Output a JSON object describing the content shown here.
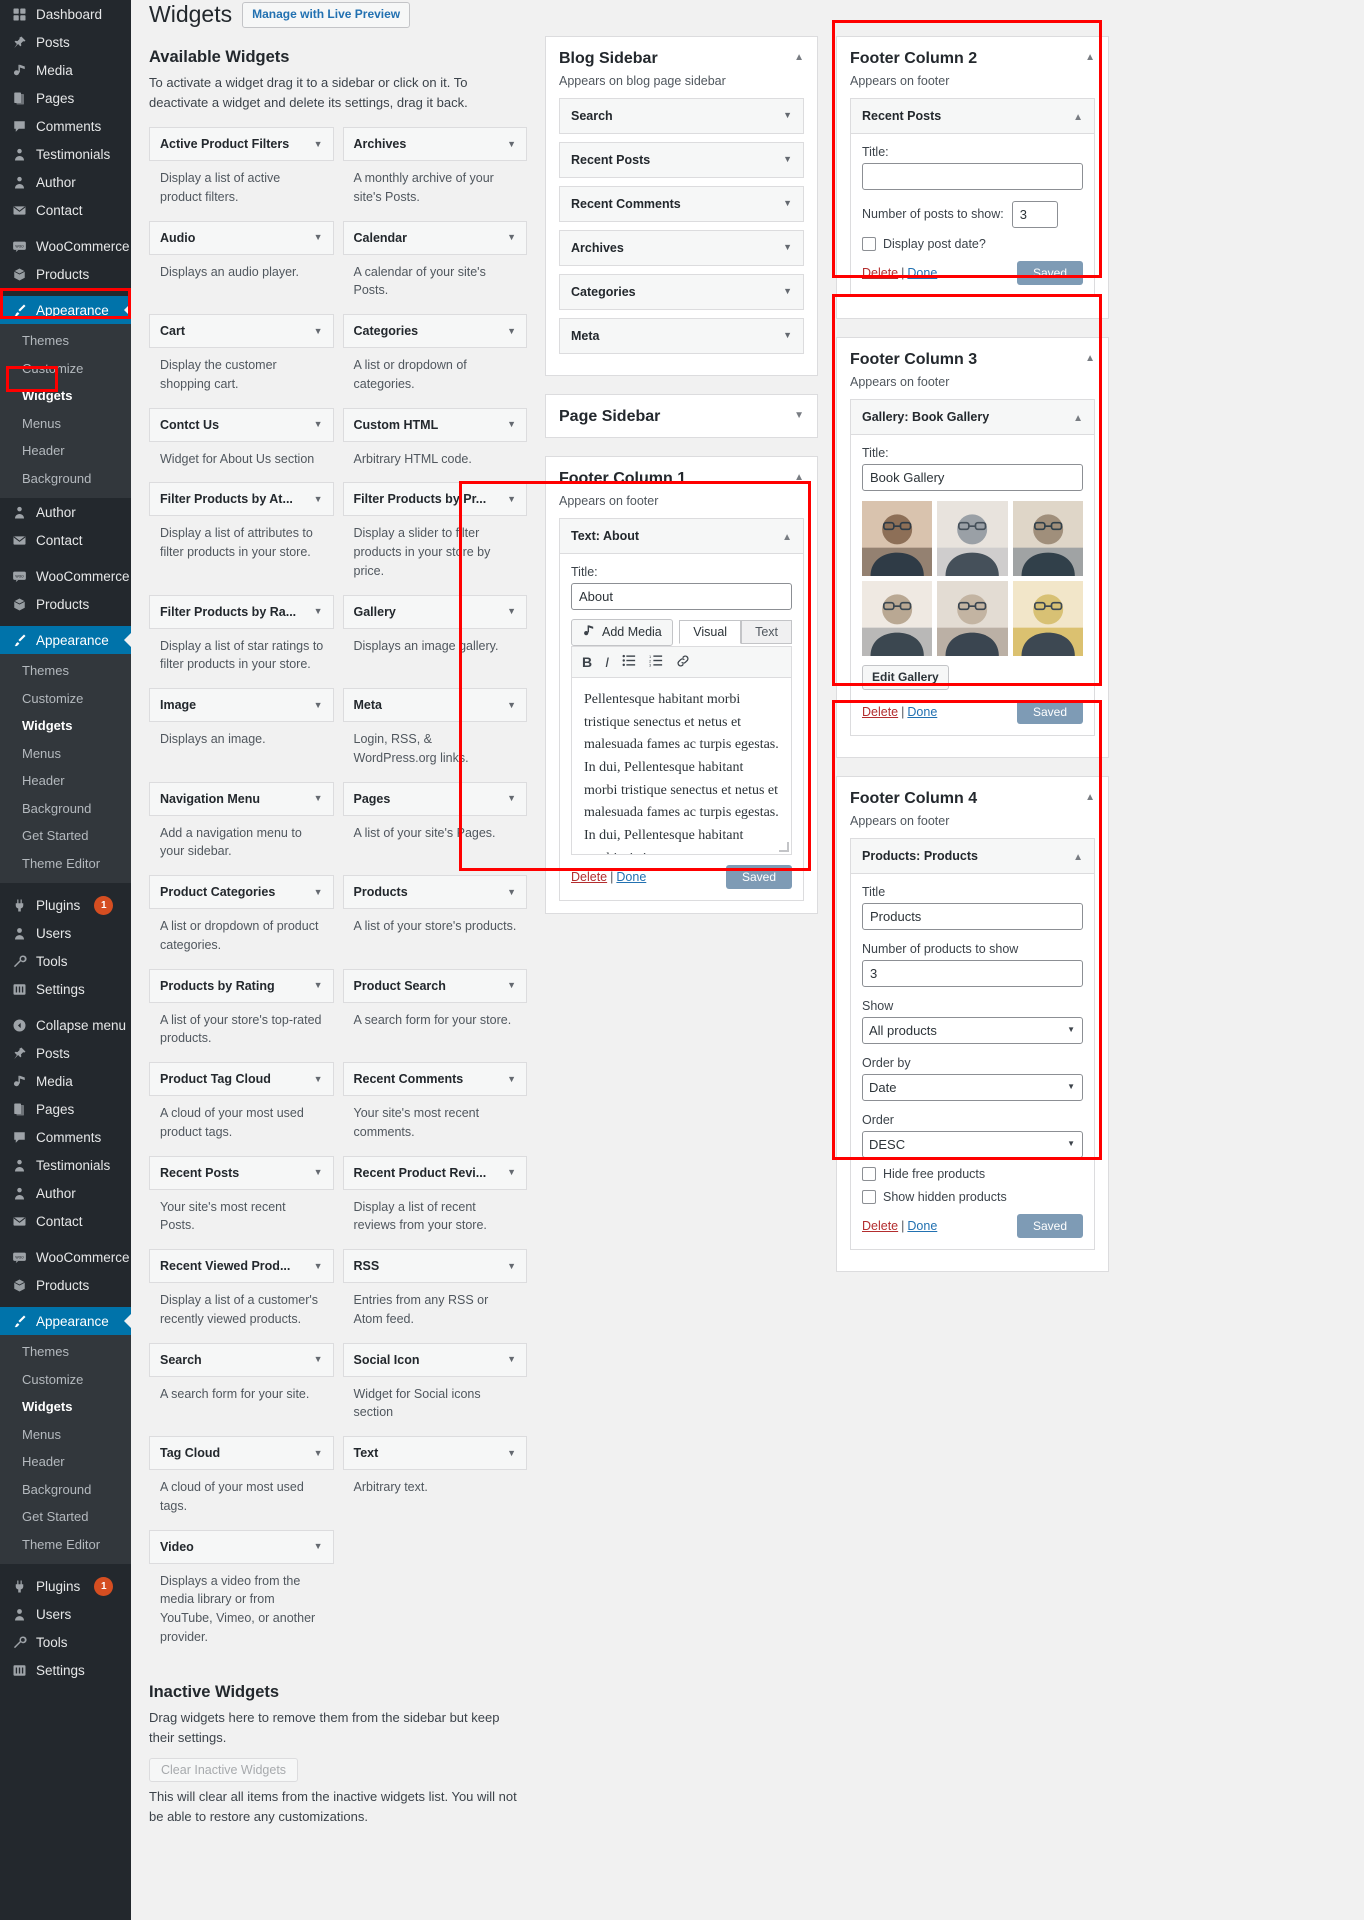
{
  "sidebar": {
    "blocks": [
      {
        "items": [
          {
            "label": "Dashboard",
            "icon": "dashboard-icon",
            "partial": true
          },
          {
            "label": "Posts",
            "icon": "pin-icon"
          },
          {
            "label": "Media",
            "icon": "media-icon"
          },
          {
            "label": "Pages",
            "icon": "pages-icon"
          },
          {
            "label": "Comments",
            "icon": "comments-icon"
          },
          {
            "label": "Testimonials",
            "icon": "user-icon"
          },
          {
            "label": "Author",
            "icon": "user-icon"
          },
          {
            "label": "Contact",
            "icon": "mail-icon"
          },
          {
            "label": "WooCommerce",
            "icon": "woo-icon",
            "gap": true
          },
          {
            "label": "Products",
            "icon": "box-icon"
          },
          {
            "label": "Appearance",
            "icon": "brush-icon",
            "current": true,
            "gap": true
          }
        ],
        "submenu": [
          {
            "label": "Themes"
          },
          {
            "label": "Customize"
          },
          {
            "label": "Widgets",
            "current": true
          },
          {
            "label": "Menus"
          },
          {
            "label": "Header"
          },
          {
            "label": "Background"
          }
        ]
      },
      {
        "items": [
          {
            "label": "Author",
            "icon": "user-icon"
          },
          {
            "label": "Contact",
            "icon": "mail-icon"
          },
          {
            "label": "WooCommerce",
            "icon": "woo-icon",
            "gap": true
          },
          {
            "label": "Products",
            "icon": "box-icon"
          },
          {
            "label": "Appearance",
            "icon": "brush-icon",
            "current": true,
            "gap": true
          }
        ],
        "submenu": [
          {
            "label": "Themes"
          },
          {
            "label": "Customize"
          },
          {
            "label": "Widgets",
            "current": true
          },
          {
            "label": "Menus"
          },
          {
            "label": "Header"
          },
          {
            "label": "Background"
          },
          {
            "label": "Get Started"
          },
          {
            "label": "Theme Editor"
          }
        ],
        "tail": [
          {
            "label": "Plugins",
            "icon": "plug-icon",
            "badge": "1",
            "gap": true
          },
          {
            "label": "Users",
            "icon": "users-icon"
          },
          {
            "label": "Tools",
            "icon": "tools-icon"
          },
          {
            "label": "Settings",
            "icon": "settings-icon"
          },
          {
            "label": "Collapse menu",
            "icon": "collapse-icon",
            "gap": true
          }
        ]
      },
      {
        "items": [
          {
            "label": "Posts",
            "icon": "pin-icon"
          },
          {
            "label": "Media",
            "icon": "media-icon"
          },
          {
            "label": "Pages",
            "icon": "pages-icon"
          },
          {
            "label": "Comments",
            "icon": "comments-icon"
          },
          {
            "label": "Testimonials",
            "icon": "user-icon"
          },
          {
            "label": "Author",
            "icon": "user-icon"
          },
          {
            "label": "Contact",
            "icon": "mail-icon"
          },
          {
            "label": "WooCommerce",
            "icon": "woo-icon",
            "gap": true
          },
          {
            "label": "Products",
            "icon": "box-icon"
          },
          {
            "label": "Appearance",
            "icon": "brush-icon",
            "current": true,
            "gap": true
          }
        ],
        "submenu": [
          {
            "label": "Themes"
          },
          {
            "label": "Customize"
          },
          {
            "label": "Widgets",
            "current": true
          },
          {
            "label": "Menus"
          },
          {
            "label": "Header"
          },
          {
            "label": "Background"
          },
          {
            "label": "Get Started"
          },
          {
            "label": "Theme Editor"
          }
        ],
        "tail": [
          {
            "label": "Plugins",
            "icon": "plug-icon",
            "badge": "1",
            "gap": true
          },
          {
            "label": "Users",
            "icon": "users-icon"
          },
          {
            "label": "Tools",
            "icon": "tools-icon"
          },
          {
            "label": "Settings",
            "icon": "settings-icon"
          }
        ]
      }
    ]
  },
  "page": {
    "title": "Widgets",
    "live_preview_button": "Manage with Live Preview",
    "available_heading": "Available Widgets",
    "available_desc": "To activate a widget drag it to a sidebar or click on it. To deactivate a widget and delete its settings, drag it back.",
    "inactive_heading": "Inactive Widgets",
    "inactive_desc": "Drag widgets here to remove them from the sidebar but keep their settings.",
    "clear_button": "Clear Inactive Widgets",
    "clear_desc": "This will clear all items from the inactive widgets list. You will not be able to restore any customizations."
  },
  "available_widgets": [
    {
      "name": "Active Product Filters",
      "desc": "Display a list of active product filters."
    },
    {
      "name": "Archives",
      "desc": "A monthly archive of your site's Posts."
    },
    {
      "name": "Audio",
      "desc": "Displays an audio player."
    },
    {
      "name": "Calendar",
      "desc": "A calendar of your site's Posts."
    },
    {
      "name": "Cart",
      "desc": "Display the customer shopping cart."
    },
    {
      "name": "Categories",
      "desc": "A list or dropdown of categories."
    },
    {
      "name": "Contct Us",
      "desc": "Widget for About Us section"
    },
    {
      "name": "Custom HTML",
      "desc": "Arbitrary HTML code."
    },
    {
      "name": "Filter Products by At...",
      "desc": "Display a list of attributes to filter products in your store."
    },
    {
      "name": "Filter Products by Pr...",
      "desc": "Display a slider to filter products in your store by price."
    },
    {
      "name": "Filter Products by Ra...",
      "desc": "Display a list of star ratings to filter products in your store."
    },
    {
      "name": "Gallery",
      "desc": "Displays an image gallery."
    },
    {
      "name": "Image",
      "desc": "Displays an image."
    },
    {
      "name": "Meta",
      "desc": "Login, RSS, & WordPress.org links."
    },
    {
      "name": "Navigation Menu",
      "desc": "Add a navigation menu to your sidebar."
    },
    {
      "name": "Pages",
      "desc": "A list of your site's Pages."
    },
    {
      "name": "Product Categories",
      "desc": "A list or dropdown of product categories."
    },
    {
      "name": "Products",
      "desc": "A list of your store's products."
    },
    {
      "name": "Products by Rating",
      "desc": "A list of your store's top-rated products."
    },
    {
      "name": "Product Search",
      "desc": "A search form for your store."
    },
    {
      "name": "Product Tag Cloud",
      "desc": "A cloud of your most used product tags."
    },
    {
      "name": "Recent Comments",
      "desc": "Your site's most recent comments."
    },
    {
      "name": "Recent Posts",
      "desc": "Your site's most recent Posts."
    },
    {
      "name": "Recent Product Revi...",
      "desc": "Display a list of recent reviews from your store."
    },
    {
      "name": "Recent Viewed Prod...",
      "desc": "Display a list of a customer's recently viewed products."
    },
    {
      "name": "RSS",
      "desc": "Entries from any RSS or Atom feed."
    },
    {
      "name": "Search",
      "desc": "A search form for your site."
    },
    {
      "name": "Social Icon",
      "desc": "Widget for Social icons section"
    },
    {
      "name": "Tag Cloud",
      "desc": "A cloud of your most used tags."
    },
    {
      "name": "Text",
      "desc": "Arbitrary text."
    },
    {
      "name": "Video",
      "desc": "Displays a video from the media library or from YouTube, Vimeo, or another provider."
    }
  ],
  "blog_sidebar": {
    "title": "Blog Sidebar",
    "subtitle": "Appears on blog page sidebar",
    "widgets": [
      "Search",
      "Recent Posts",
      "Recent Comments",
      "Archives",
      "Categories",
      "Meta"
    ]
  },
  "page_sidebar": {
    "title": "Page Sidebar"
  },
  "footer_column_1": {
    "title": "Footer Column 1",
    "subtitle": "Appears on footer",
    "text_widget": {
      "head_prefix": "Text:",
      "head_name": "About",
      "title_label": "Title:",
      "title_value": "About",
      "add_media": "Add Media",
      "tab_visual": "Visual",
      "tab_text": "Text",
      "toolbar": [
        "bold-icon",
        "italic-icon",
        "bullet-list-icon",
        "numbered-list-icon",
        "link-icon"
      ],
      "content": "Pellentesque habitant morbi tristique senectus et netus et malesuada fames ac turpis egestas. In dui, Pellentesque habitant morbi tristique senectus et netus et malesuada fames ac turpis egestas. In dui, Pellentesque habitant morbi tristique senectus et netus et malesuada fames ac turpis egestas.",
      "delete": "Delete",
      "done": "Done",
      "saved": "Saved"
    }
  },
  "footer_column_2": {
    "title": "Footer Column 2",
    "subtitle": "Appears on footer",
    "widget": {
      "head": "Recent Posts",
      "title_label": "Title:",
      "title_value": "",
      "count_label": "Number of posts to show:",
      "count_value": "3",
      "checkbox_label": "Display post date?",
      "checkbox_checked": false,
      "delete": "Delete",
      "done": "Done",
      "saved": "Saved"
    }
  },
  "footer_column_3": {
    "title": "Footer Column 3",
    "subtitle": "Appears on footer",
    "widget": {
      "head_prefix": "Gallery:",
      "head_name": "Book Gallery",
      "title_label": "Title:",
      "title_value": "Book Gallery",
      "edit_gallery": "Edit Gallery",
      "thumbs": [
        "woman-glasses-laptop",
        "senior-man-paper",
        "man-hat-glasses",
        "woman-tablet-desk",
        "woman-reading-book",
        "woman-yellow-book"
      ],
      "delete": "Delete",
      "done": "Done",
      "saved": "Saved"
    }
  },
  "footer_column_4": {
    "title": "Footer Column 4",
    "subtitle": "Appears on footer",
    "widget": {
      "head_prefix": "Products:",
      "head_name": "Products",
      "title_label": "Title",
      "title_value": "Products",
      "count_label": "Number of products to show",
      "count_value": "3",
      "show_label": "Show",
      "show_value": "All products",
      "orderby_label": "Order by",
      "orderby_value": "Date",
      "order_label": "Order",
      "order_value": "DESC",
      "hide_free_label": "Hide free products",
      "show_hidden_label": "Show hidden products",
      "delete": "Delete",
      "done": "Done",
      "saved": "Saved"
    }
  }
}
